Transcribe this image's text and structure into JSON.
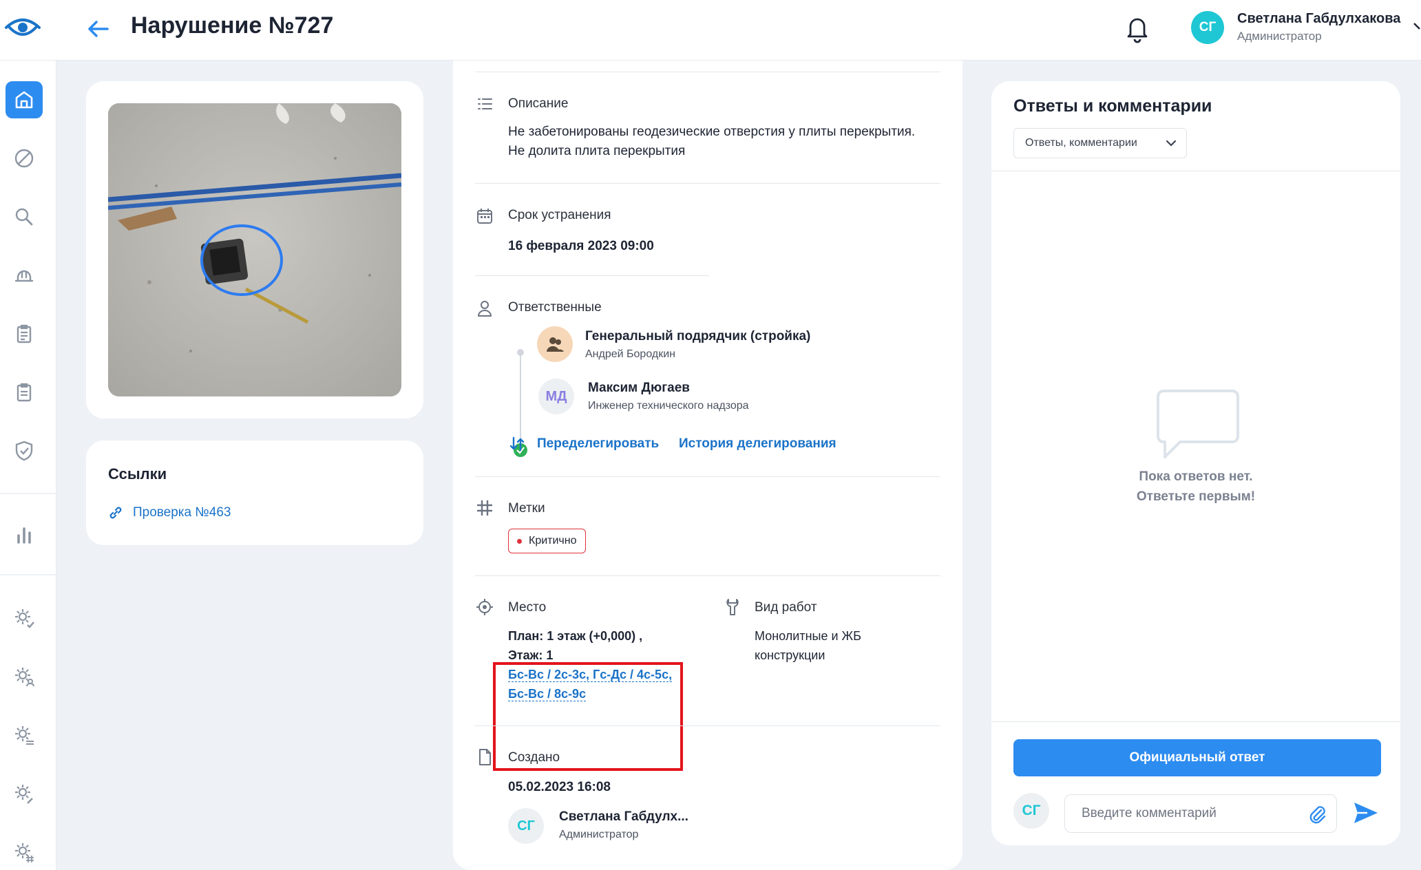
{
  "header": {
    "title": "Нарушение №727",
    "user_initials": "СГ",
    "user_name": "Светлана Габдулхакова",
    "user_role": "Администратор"
  },
  "sidebar": {
    "items": [
      {
        "name": "home-icon",
        "active": true
      },
      {
        "name": "ban-icon"
      },
      {
        "name": "search-icon"
      },
      {
        "name": "hardhat-icon"
      },
      {
        "name": "clipboard-icon"
      },
      {
        "name": "clipboard-alt-icon"
      },
      {
        "name": "shield-check-icon"
      },
      {
        "name": "bar-chart-icon"
      },
      {
        "name": "gear-check-icon"
      },
      {
        "name": "gear-user-icon"
      },
      {
        "name": "gear-sliders-icon"
      },
      {
        "name": "gear-wrench-icon"
      },
      {
        "name": "gear-hash-icon"
      }
    ]
  },
  "links": {
    "title": "Ссылки",
    "items": [
      "Проверка №463"
    ]
  },
  "details": {
    "description_label": "Описание",
    "description_text": "Не забетонированы геодезические отверстия у плиты перекрытия. Не долита плита перекрытия",
    "deadline_label": "Срок устранения",
    "deadline_value": "16 февраля 2023 09:00",
    "responsible_label": "Ответственные",
    "responsible": [
      {
        "name": "Генеральный подрядчик (стройка)",
        "role": "Андрей Бородкин"
      },
      {
        "initials": "МД",
        "name": "Максим Дюгаев",
        "role": "Инженер технического надзора"
      }
    ],
    "redelegate_label": "Переделегировать",
    "history_label": "История делегирования",
    "tags_label": "Метки",
    "tag": "Критично",
    "place_label": "Место",
    "place_plan": "План: 1 этаж (+0,000) ,",
    "place_floor": "Этаж: 1",
    "place_axes_1": "Бс-Вс / 2с-3с, Гс-Дс / 4с-5с,",
    "place_axes_2": "Бс-Вс / 8с-9с",
    "work_type_label": "Вид работ",
    "work_type_value": "Монолитные и ЖБ конструкции",
    "created_label": "Создано",
    "created_date": "05.02.2023 16:08",
    "creator_initials": "СГ",
    "creator_name": "Светлана Габдулх...",
    "creator_role": "Администратор"
  },
  "comments": {
    "title": "Ответы и комментарии",
    "filter": "Ответы, комментарии",
    "empty_line1": "Пока ответов нет.",
    "empty_line2": "Ответьте первым!",
    "official_button": "Официальный ответ",
    "user_initials": "СГ",
    "input_placeholder": "Введите комментарий"
  },
  "colors": {
    "accent": "#2d8cf0",
    "link": "#1a73c8",
    "critical": "#e0323a",
    "avatar": "#1fc7d4"
  }
}
